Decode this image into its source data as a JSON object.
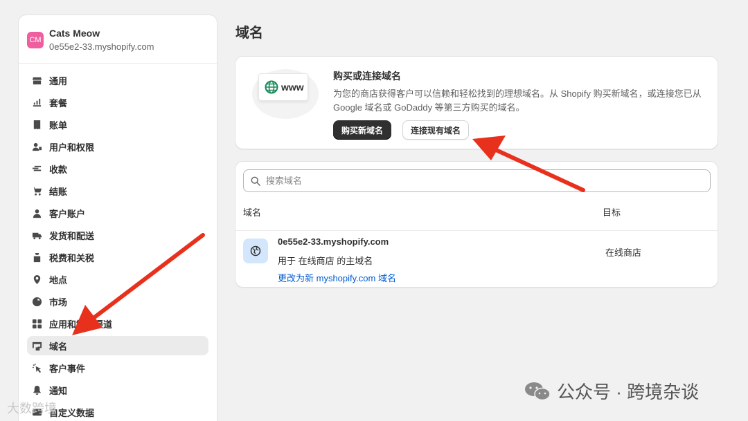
{
  "store": {
    "initials": "CM",
    "name": "Cats Meow",
    "domain": "0e55e2-33.myshopify.com"
  },
  "sidebar": {
    "items": [
      {
        "label": "通用",
        "icon": "store-icon"
      },
      {
        "label": "套餐",
        "icon": "plan-icon"
      },
      {
        "label": "账单",
        "icon": "billing-icon"
      },
      {
        "label": "用户和权限",
        "icon": "users-icon"
      },
      {
        "label": "收款",
        "icon": "payments-icon"
      },
      {
        "label": "结账",
        "icon": "cart-icon"
      },
      {
        "label": "客户账户",
        "icon": "person-icon"
      },
      {
        "label": "发货和配送",
        "icon": "truck-icon"
      },
      {
        "label": "税费和关税",
        "icon": "tax-icon"
      },
      {
        "label": "地点",
        "icon": "location-icon"
      },
      {
        "label": "市场",
        "icon": "globe-icon"
      },
      {
        "label": "应用和销售渠道",
        "icon": "apps-icon"
      },
      {
        "label": "域名",
        "icon": "domain-icon",
        "active": true
      },
      {
        "label": "客户事件",
        "icon": "cursor-icon"
      },
      {
        "label": "通知",
        "icon": "bell-icon"
      },
      {
        "label": "自定义数据",
        "icon": "data-icon"
      }
    ]
  },
  "page": {
    "title": "域名"
  },
  "promo": {
    "illustration_text": "www",
    "title": "购买或连接域名",
    "description": "为您的商店获得客户可以信赖和轻松找到的理想域名。从 Shopify 购买新域名，或连接您已从 Google 域名或 GoDaddy 等第三方购买的域名。",
    "buy_label": "购买新域名",
    "connect_label": "连接现有域名"
  },
  "domains": {
    "search_placeholder": "搜索域名",
    "col_domain": "域名",
    "col_target": "目标",
    "rows": [
      {
        "name": "0e55e2-33.myshopify.com",
        "use": "用于 在线商店 的主域名",
        "link": "更改为新 myshopify.com 域名",
        "target": "在线商店"
      }
    ]
  },
  "watermark": {
    "main": "公众号 · 跨境杂谈",
    "bottom": "大数跨境"
  },
  "colors": {
    "annotation_arrow": "#e8311d",
    "primary_button": "#303030",
    "link": "#005bd3",
    "avatar": "#ef5e9f"
  }
}
